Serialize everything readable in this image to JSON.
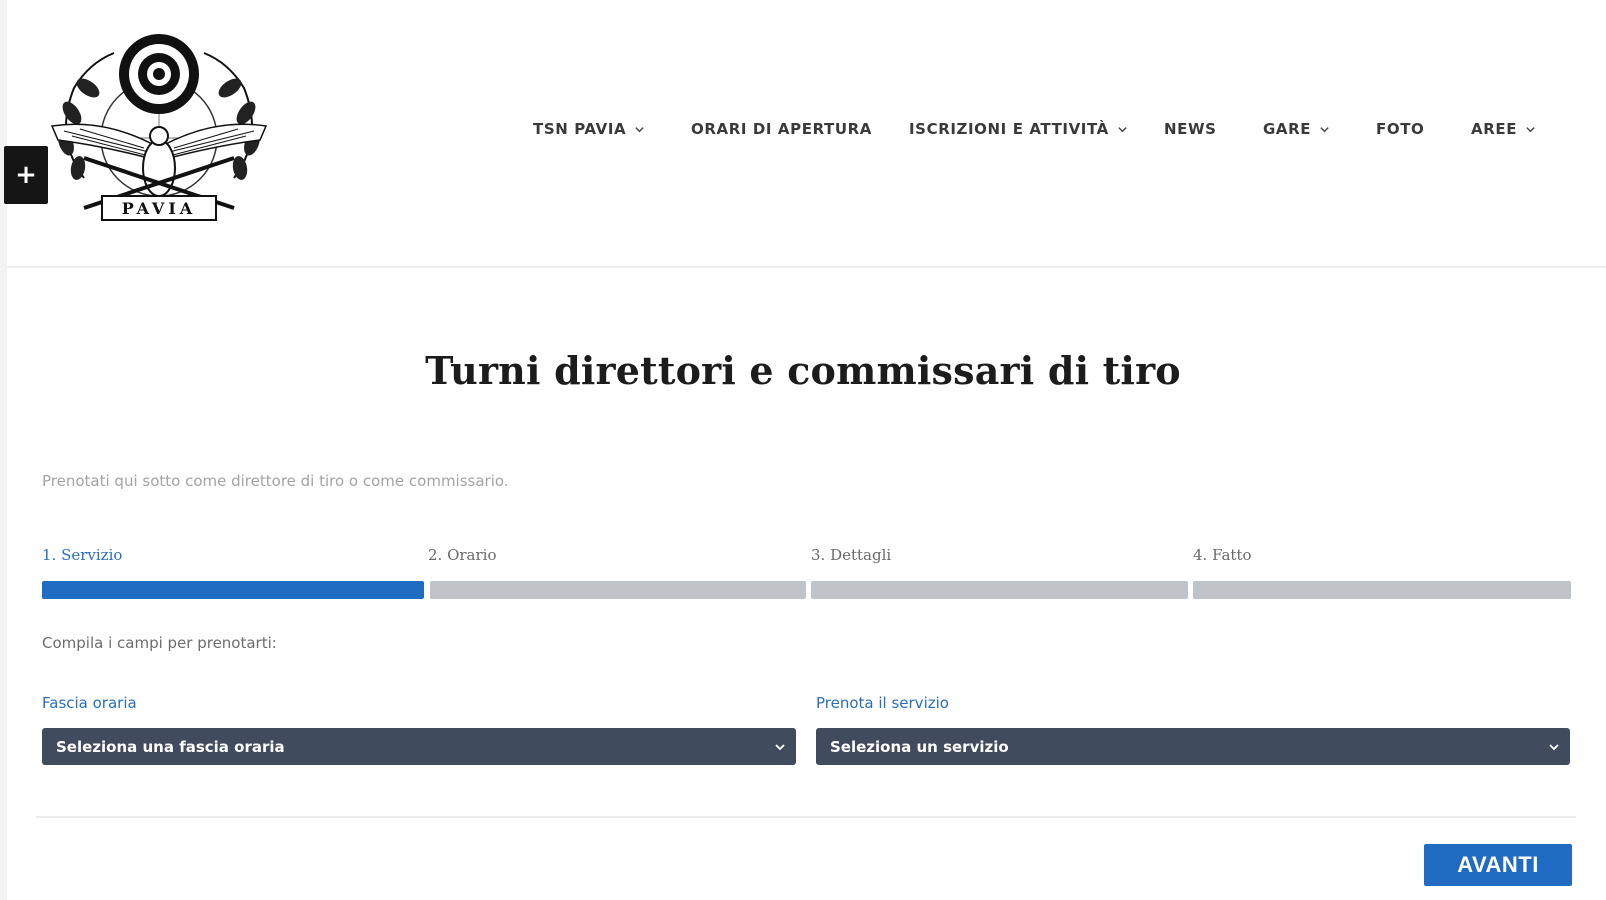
{
  "header": {
    "logo_text": "PAVIA",
    "sidebar_toggle": "+",
    "nav": [
      {
        "label": "TSN PAVIA",
        "has_dropdown": true
      },
      {
        "label": "ORARI DI APERTURA",
        "has_dropdown": false
      },
      {
        "label": "ISCRIZIONI E ATTIVITÀ",
        "has_dropdown": true
      },
      {
        "label": "NEWS",
        "has_dropdown": false
      },
      {
        "label": "GARE",
        "has_dropdown": true
      },
      {
        "label": "FOTO",
        "has_dropdown": false
      },
      {
        "label": "AREE",
        "has_dropdown": true
      }
    ]
  },
  "main": {
    "title": "Turni direttori e commissari di tiro",
    "intro": "Prenotati qui sotto come direttore di tiro o come commissario.",
    "steps": [
      {
        "label": "1. Servizio",
        "active": true
      },
      {
        "label": "2. Orario",
        "active": false
      },
      {
        "label": "3. Dettagli",
        "active": false
      },
      {
        "label": "4. Fatto",
        "active": false
      }
    ],
    "form_hint": "Compila i campi per prenotarti:",
    "fields": {
      "time_slot": {
        "label": "Fascia oraria",
        "value": "Seleziona una fascia oraria"
      },
      "service": {
        "label": "Prenota il servizio",
        "value": "Seleziona un servizio"
      }
    },
    "next_button": "AVANTI"
  },
  "colors": {
    "accent": "#1f6cc2",
    "select_bg": "#414b5e",
    "inactive_step": "#bfc4c8",
    "label_blue": "#2a6fbd"
  }
}
